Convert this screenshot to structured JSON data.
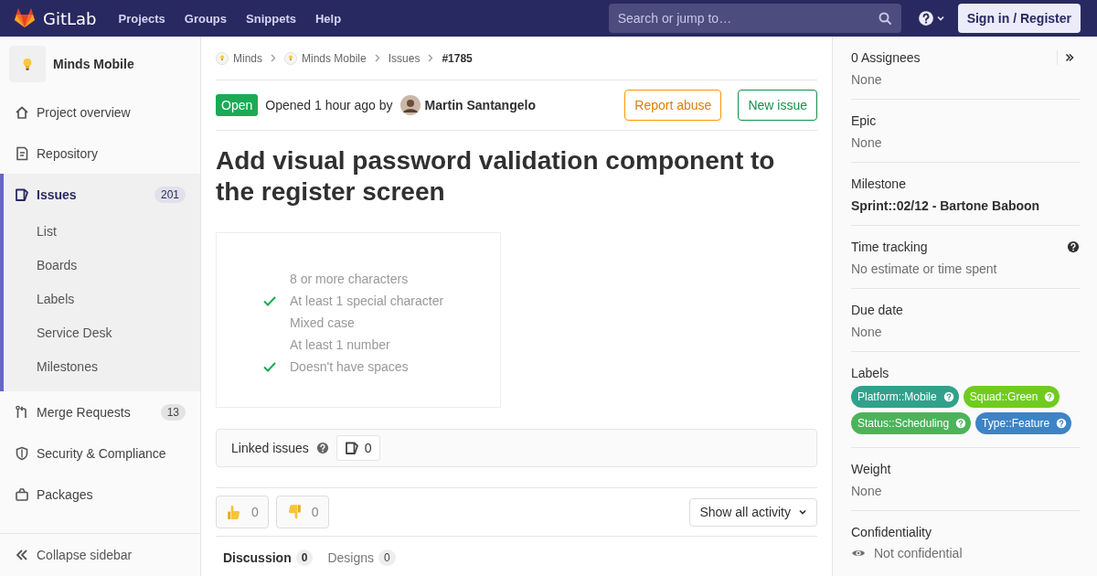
{
  "navbar": {
    "brand": "GitLab",
    "links": [
      "Projects",
      "Groups",
      "Snippets",
      "Help"
    ],
    "search": {
      "placeholder": "Search or jump to…"
    },
    "sign_in": "Sign in / Register"
  },
  "sidebar": {
    "project": "Minds Mobile",
    "items": [
      {
        "label": "Project overview",
        "selected": false
      },
      {
        "label": "Repository",
        "selected": false
      },
      {
        "label": "Issues",
        "count": "201",
        "selected": true,
        "children": [
          {
            "label": "List",
            "selected": false
          },
          {
            "label": "Boards",
            "selected": false
          },
          {
            "label": "Labels",
            "selected": false
          },
          {
            "label": "Service Desk",
            "selected": false
          },
          {
            "label": "Milestones",
            "selected": false
          }
        ]
      },
      {
        "label": "Merge Requests",
        "count": "13",
        "selected": false
      },
      {
        "label": "Security & Compliance",
        "selected": false
      },
      {
        "label": "Packages",
        "selected": false
      }
    ],
    "collapse": "Collapse sidebar"
  },
  "breadcrumbs": [
    "Minds",
    "Minds Mobile",
    "Issues",
    "#1785"
  ],
  "issue": {
    "status": "Open",
    "opened": "Opened 1 hour ago by",
    "author": "Martin Santangelo",
    "buttons": [
      {
        "label": "Report abuse",
        "kind": "warning"
      },
      {
        "label": "New issue",
        "kind": "success"
      }
    ],
    "title": "Add visual password validation component to the register screen",
    "checklist": [
      {
        "text": "8 or more characters",
        "checked": false
      },
      {
        "text": "At least 1 special character",
        "checked": true
      },
      {
        "text": "Mixed case",
        "checked": false
      },
      {
        "text": "At least 1 number",
        "checked": false
      },
      {
        "text": "Doesn't have spaces",
        "checked": true
      }
    ]
  },
  "linked_issues": {
    "label": "Linked issues",
    "count": "0"
  },
  "reactions": [
    {
      "kind": "thumbsup",
      "count": "0"
    },
    {
      "kind": "thumbsdown",
      "count": "0"
    }
  ],
  "activity_filter": "Show all activity",
  "tabs": [
    {
      "label": "Discussion",
      "count": "0",
      "selected": true
    },
    {
      "label": "Designs",
      "count": "0",
      "selected": false
    }
  ],
  "right_sidebar": [
    {
      "kind": "assignees",
      "title": "0 Assignees",
      "value": "None"
    },
    {
      "kind": "text",
      "title": "Epic",
      "value": "None"
    },
    {
      "kind": "bold",
      "title": "Milestone",
      "value": "Sprint::02/12 - Bartone Baboon"
    },
    {
      "kind": "help",
      "title": "Time tracking",
      "value": "No estimate or time spent"
    },
    {
      "kind": "text",
      "title": "Due date",
      "value": "None"
    },
    {
      "kind": "labels",
      "title": "Labels",
      "labels": [
        {
          "text": "Platform::Mobile",
          "color": "#31a18b"
        },
        {
          "text": "Squad::Green",
          "color": "#6fcc1e"
        },
        {
          "text": "Status::Scheduling",
          "color": "#4cb35a"
        },
        {
          "text": "Type::Feature",
          "color": "#3d84c6"
        }
      ]
    },
    {
      "kind": "text",
      "title": "Weight",
      "value": "None"
    },
    {
      "kind": "confidential",
      "title": "Confidentiality",
      "value": "Not confidential"
    }
  ]
}
